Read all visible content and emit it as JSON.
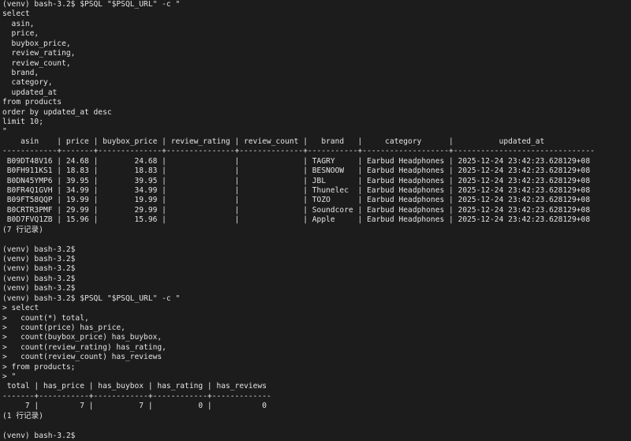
{
  "terminal": {
    "lines": [
      "(venv) bash-3.2$ $PSQL \"$PSQL_URL\" -c \"",
      "select",
      "  asin,",
      "  price,",
      "  buybox_price,",
      "  review_rating,",
      "  review_count,",
      "  brand,",
      "  category,",
      "  updated_at",
      "from products",
      "order by updated_at desc",
      "limit 10;",
      "\"",
      "    asin    | price | buybox_price | review_rating | review_count |   brand   |     category      |          updated_at",
      "------------+-------+--------------+---------------+--------------+-----------+-------------------+-------------------------------",
      " B09DT48V16 | 24.68 |        24.68 |               |              | TAGRY     | Earbud Headphones | 2025-12-24 23:42:23.628129+08",
      " B0FH911KS1 | 18.83 |        18.83 |               |              | BESNOOW   | Earbud Headphones | 2025-12-24 23:42:23.628129+08",
      " B0DN45YMP6 | 39.95 |        39.95 |               |              | JBL       | Earbud Headphones | 2025-12-24 23:42:23.628129+08",
      " B0FR4Q1GVH | 34.99 |        34.99 |               |              | Thunelec  | Earbud Headphones | 2025-12-24 23:42:23.628129+08",
      " B09FT58QQP | 19.99 |        19.99 |               |              | TOZO      | Earbud Headphones | 2025-12-24 23:42:23.628129+08",
      " B0CRTR3PMF | 29.99 |        29.99 |               |              | Soundcore | Earbud Headphones | 2025-12-24 23:42:23.628129+08",
      " B0D7FVQ1ZB | 15.96 |        15.96 |               |              | Apple     | Earbud Headphones | 2025-12-24 23:42:23.628129+08",
      "(7 行记录)",
      "",
      "(venv) bash-3.2$",
      "(venv) bash-3.2$",
      "(venv) bash-3.2$",
      "(venv) bash-3.2$",
      "(venv) bash-3.2$",
      "(venv) bash-3.2$ $PSQL \"$PSQL_URL\" -c \"",
      "> select",
      ">   count(*) total,",
      ">   count(price) has_price,",
      ">   count(buybox_price) has_buybox,",
      ">   count(review_rating) has_rating,",
      ">   count(review_count) has_reviews",
      "> from products;",
      "> \"",
      " total | has_price | has_buybox | has_rating | has_reviews",
      "-------+-----------+------------+------------+-------------",
      "     7 |         7 |          7 |          0 |           0",
      "(1 行记录)",
      "",
      "(venv) bash-3.2$ "
    ]
  }
}
